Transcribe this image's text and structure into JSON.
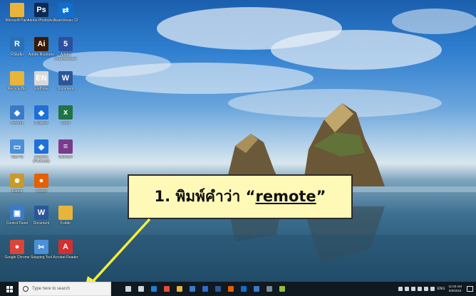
{
  "desktop": {
    "icons": [
      {
        "label": "Microsoft Paint",
        "icon": "folder-icon",
        "color": "#e8b53a"
      },
      {
        "label": "Adobe Photoshop",
        "icon": "photoshop-icon",
        "color": "#0b2a52"
      },
      {
        "label": "TeamViewer 12",
        "icon": "teamviewer-icon",
        "color": "#0e6fd1"
      },
      {
        "label": "RStudio",
        "icon": "r-icon",
        "color": "#2b6fb6"
      },
      {
        "label": "Adobe Illustrator",
        "icon": "illustrator-icon",
        "color": "#3a1a00"
      },
      {
        "label": "Adobe Dreamweaver",
        "icon": "html5-icon",
        "color": "#2d4f9e"
      },
      {
        "label": "Recycle Bin",
        "icon": "folder-icon",
        "color": "#e8b53a"
      },
      {
        "label": "EndNote",
        "icon": "document-icon",
        "color": "#d8d8d8"
      },
      {
        "label": "Document",
        "icon": "word-icon",
        "color": "#2b579a"
      },
      {
        "label": "Network",
        "icon": "network-icon",
        "color": "#3a7bc8"
      },
      {
        "label": "Dropbox",
        "icon": "dropbox-icon",
        "color": "#1f6fd8"
      },
      {
        "label": "Excel",
        "icon": "excel-icon",
        "color": "#217346"
      },
      {
        "label": "This PC",
        "icon": "computer-icon",
        "color": "#4a8fd8"
      },
      {
        "label": "Dropbox (Personal)",
        "icon": "dropbox-icon",
        "color": "#1f6fd8"
      },
      {
        "label": "WinRAR",
        "icon": "winrar-icon",
        "color": "#7a3b8c"
      },
      {
        "label": "Kamal",
        "icon": "user-icon",
        "color": "#c89a2a"
      },
      {
        "label": "Firefox",
        "icon": "firefox-icon",
        "color": "#e66000"
      },
      {
        "label": "Control Panel",
        "icon": "control-panel-icon",
        "color": "#3a7bc8"
      },
      {
        "label": "Document",
        "icon": "word-icon",
        "color": "#2b579a"
      },
      {
        "label": "Folder",
        "icon": "folder-icon",
        "color": "#e8b53a"
      },
      {
        "label": "Google Chrome",
        "icon": "chrome-icon",
        "color": "#db4437"
      },
      {
        "label": "Snipping Tool",
        "icon": "snip-icon",
        "color": "#4a8fd8"
      },
      {
        "label": "Acrobat Reader",
        "icon": "acrobat-icon",
        "color": "#d32f2f"
      }
    ]
  },
  "callout": {
    "prefix": "1. พิมพ์คำว่า “",
    "word": "remote",
    "suffix": "”"
  },
  "taskbar": {
    "search_placeholder": "Type here to search",
    "apps": [
      {
        "icon": "microphone-icon",
        "color": "#cfd6de"
      },
      {
        "icon": "task-view-icon",
        "color": "#cfd6de"
      },
      {
        "icon": "edge-icon",
        "color": "#1e7fd8"
      },
      {
        "icon": "chrome-icon",
        "color": "#e74c3c"
      },
      {
        "icon": "file-explorer-icon",
        "color": "#e8b53a"
      },
      {
        "icon": "store-icon",
        "color": "#3a7bc8"
      },
      {
        "icon": "mail-icon",
        "color": "#2d6ccc"
      },
      {
        "icon": "word-icon",
        "color": "#2b579a"
      },
      {
        "icon": "firefox-icon",
        "color": "#e66000"
      },
      {
        "icon": "teamviewer-icon",
        "color": "#0e6fd1"
      },
      {
        "icon": "media-icon",
        "color": "#3a7bc8"
      },
      {
        "icon": "settings-icon",
        "color": "#7a8a99"
      },
      {
        "icon": "feather-icon",
        "color": "#8fbf3a"
      }
    ],
    "tray": {
      "lang": "ENG",
      "time": "11:03 AM",
      "date": "5/6/2018"
    }
  }
}
